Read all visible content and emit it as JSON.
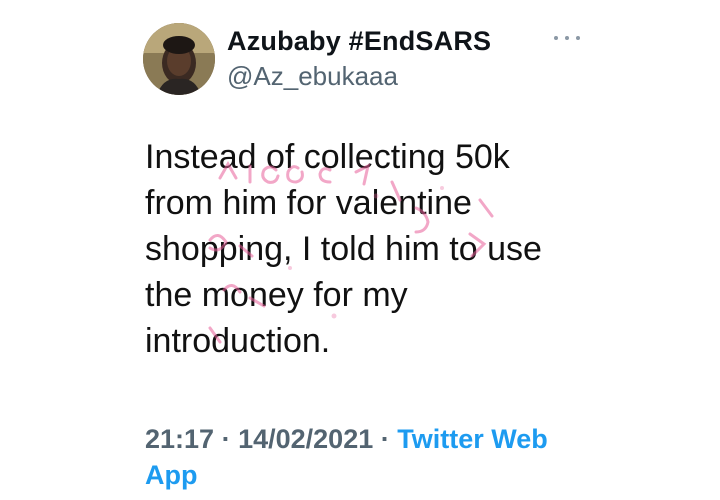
{
  "author": {
    "display_name": "Azubaby #EndSARS",
    "handle": "@Az_ebukaaa"
  },
  "more_icon": "more-horizontal-icon",
  "tweet": {
    "lines": [
      "Instead of collecting 50k",
      "from him for valentine",
      "shopping, I told him to use",
      "the money for my",
      "introduction."
    ]
  },
  "meta": {
    "time": "21:17",
    "separator": "·",
    "date": "14/02/2021",
    "separator2": "·",
    "source_line1": "Twitter Web",
    "source_line2": "App"
  },
  "colors": {
    "text": "#0f1419",
    "secondary": "#536471",
    "link": "#1d9bf0",
    "watermark": "#e8609a"
  }
}
